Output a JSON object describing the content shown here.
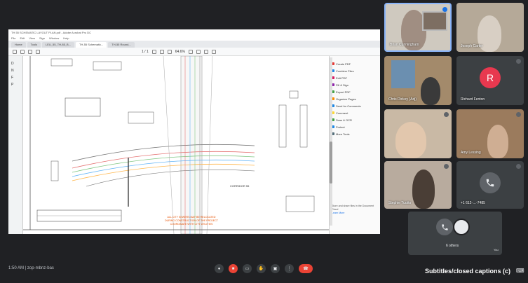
{
  "shared_screen": {
    "window_title": "TH 55 SCHEMATIC LAYOUT PLAN.pdf - Adobe Acrobat Pro DC",
    "menu": [
      "File",
      "Edit",
      "View",
      "Sign",
      "Window",
      "Help"
    ],
    "tabs": [
      "Home",
      "Tools",
      "LEU_55_TH-85_B...",
      "TH-55 Schematic...",
      "TH-55 Round..."
    ],
    "page_indicator": "1 / 1",
    "zoom_level": "64.6%",
    "left_rail": [
      "D",
      "N",
      "F",
      "P"
    ],
    "drawing_callout": [
      "ALL CITY SEWERS MAY BE RELOCATED",
      "DURING CONSTRUCTION OF THE PROJECT",
      "COORDINATE WITH CITY UTILITIES"
    ],
    "drawing_label": "CORRIDOR 55",
    "side_panel": [
      {
        "label": "Create PDF",
        "color": "#e53935"
      },
      {
        "label": "Combine Files",
        "color": "#1e88e5"
      },
      {
        "label": "Edit PDF",
        "color": "#d81b60"
      },
      {
        "label": "Fill & Sign",
        "color": "#8e24aa"
      },
      {
        "label": "Export PDF",
        "color": "#43a047"
      },
      {
        "label": "Organize Pages",
        "color": "#fb8c00"
      },
      {
        "label": "Send for Comments",
        "color": "#1e88e5"
      },
      {
        "label": "Comment",
        "color": "#fdd835"
      },
      {
        "label": "Scan & OCR",
        "color": "#43a047"
      },
      {
        "label": "Protect",
        "color": "#1e88e5"
      },
      {
        "label": "More Tools",
        "color": "#546e7a"
      }
    ],
    "side_footer": "Store and share files in the Document Cloud",
    "side_footer_link": "Learn More"
  },
  "participants": [
    {
      "name": "Brian Cunningham",
      "mic_active": true
    },
    {
      "name": "Joseph Carter",
      "mic_active": false
    },
    {
      "name": "Chris Dickey (Adj)",
      "mic_active": false
    },
    {
      "name": "Richard Fenton",
      "avatar_letter": "R",
      "avatar_color": "#e8384f",
      "mic_active": false
    },
    {
      "name": "",
      "mic_active": false
    },
    {
      "name": "Amy Lessing",
      "mic_active": false
    },
    {
      "name": "Stephie Tuotto",
      "mic_active": false
    },
    {
      "name": "+1 612-…-7485",
      "mic_active": false
    }
  ],
  "others_tile": {
    "label": "6 others"
  },
  "bottom_bar": {
    "time_text": "1:50 AM  |  zop-mbnz-bas",
    "captions_text": "Subtitles/closed captions (c)",
    "mini_labels": [
      "You"
    ],
    "icons": [
      "mic-icon",
      "camera-icon",
      "captions-icon",
      "raise-hand-icon",
      "present-icon",
      "more-icon",
      "end-call-icon"
    ]
  }
}
